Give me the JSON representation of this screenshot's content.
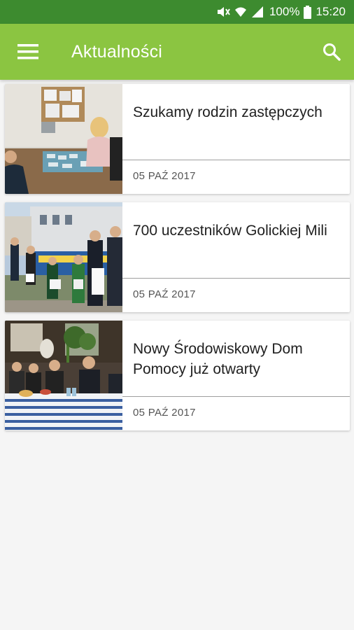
{
  "status_bar": {
    "battery_text": "100%",
    "time": "15:20"
  },
  "app_bar": {
    "title": "Aktualności",
    "background_color": "#8bc541",
    "status_color": "#3d8b2f"
  },
  "articles": [
    {
      "title": "Szukamy rodzin zastępczych",
      "date": "05 PAŹ 2017"
    },
    {
      "title": "700 uczestników Golickiej Mili",
      "date": "05 PAŹ 2017"
    },
    {
      "title": "Nowy Środowiskowy Dom Pomocy już otwarty",
      "date": "05 PAŹ 2017"
    }
  ]
}
